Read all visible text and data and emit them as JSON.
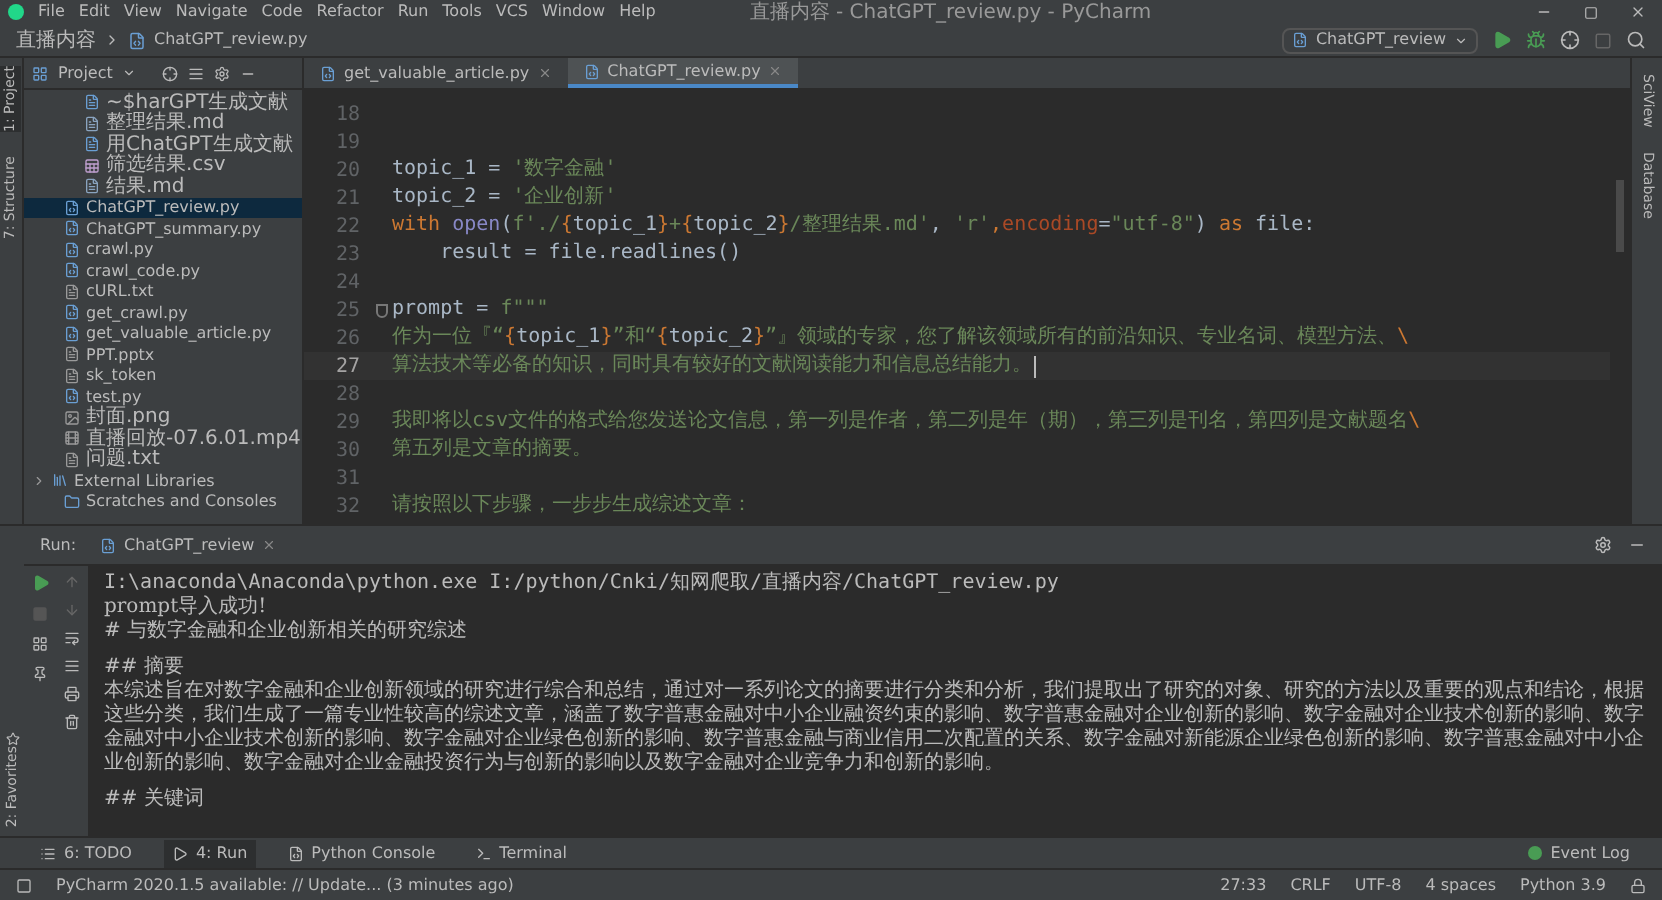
{
  "window": {
    "title": "直播内容 - ChatGPT_review.py - PyCharm"
  },
  "menu": [
    "File",
    "Edit",
    "View",
    "Navigate",
    "Code",
    "Refactor",
    "Run",
    "Tools",
    "VCS",
    "Window",
    "Help"
  ],
  "breadcrumb": [
    "直播内容",
    "ChatGPT_review.py"
  ],
  "run_config": "ChatGPT_review",
  "left_strip": [
    "1: Project",
    "7: Structure",
    "2: Favorites"
  ],
  "right_strip": [
    "SciView",
    "Database"
  ],
  "project": {
    "title": "Project",
    "tree": [
      {
        "children": [
          {
            "label": "~$harGPT生成文献",
            "kind": "doc",
            "selected": false
          },
          {
            "label": "整理结果.md",
            "kind": "md",
            "selected": false
          },
          {
            "label": "用ChatGPT生成文献",
            "kind": "doc",
            "selected": false
          },
          {
            "label": "筛选结果.csv",
            "kind": "csv",
            "selected": false
          },
          {
            "label": "结果.md",
            "kind": "md",
            "selected": false
          }
        ]
      },
      {
        "label": "ChatGPT_review.py",
        "kind": "py",
        "selected": true
      },
      {
        "label": "ChatGPT_summary.py",
        "kind": "py",
        "selected": false
      },
      {
        "label": "crawl.py",
        "kind": "py",
        "selected": false
      },
      {
        "label": "crawl_code.py",
        "kind": "py",
        "selected": false
      },
      {
        "label": "cURL.txt",
        "kind": "txt",
        "selected": false
      },
      {
        "label": "get_crawl.py",
        "kind": "py",
        "selected": false
      },
      {
        "label": "get_valuable_article.py",
        "kind": "py",
        "selected": false
      },
      {
        "label": "PPT.pptx",
        "kind": "txt",
        "selected": false
      },
      {
        "label": "sk_token",
        "kind": "txt",
        "selected": false
      },
      {
        "label": "test.py",
        "kind": "py",
        "selected": false
      },
      {
        "label": "封面.png",
        "kind": "png",
        "selected": false
      },
      {
        "label": "直播回放-07.6.01.mp4",
        "kind": "mp4",
        "selected": false
      },
      {
        "label": "问题.txt",
        "kind": "txt",
        "selected": false
      },
      {
        "label": "External Libraries",
        "kind": "lib",
        "expanded": false,
        "selected": false
      },
      {
        "label": "Scratches and Consoles",
        "kind": "scratch",
        "selected": false
      }
    ]
  },
  "editor_tabs": [
    {
      "label": "get_valuable_article.py",
      "selected": false
    },
    {
      "label": "ChatGPT_review.py",
      "selected": true
    }
  ],
  "code_lines": [
    {
      "number": "18",
      "current": false
    },
    {
      "number": "19",
      "current": false
    },
    {
      "number": "20",
      "current": false,
      "tokens": [
        {
          "kind": "plain",
          "text": "topic_1 = "
        },
        {
          "kind": "string",
          "text": "'数字金融'"
        }
      ]
    },
    {
      "number": "21",
      "current": false,
      "tokens": [
        {
          "kind": "plain",
          "text": "topic_2 = "
        },
        {
          "kind": "string",
          "text": "'企业创新'"
        }
      ]
    },
    {
      "number": "22",
      "current": false,
      "tokens": [
        {
          "kind": "keyword",
          "text": "with "
        },
        {
          "kind": "builtin",
          "text": "open"
        },
        {
          "kind": "plain",
          "text": "("
        },
        {
          "kind": "string",
          "text": "f'./"
        },
        {
          "kind": "brace",
          "text": "{"
        },
        {
          "kind": "plain",
          "text": "topic_1"
        },
        {
          "kind": "brace",
          "text": "}"
        },
        {
          "kind": "string",
          "text": "+"
        },
        {
          "kind": "brace",
          "text": "{"
        },
        {
          "kind": "plain",
          "text": "topic_2"
        },
        {
          "kind": "brace",
          "text": "}"
        },
        {
          "kind": "string",
          "text": "/整理结果.md'"
        },
        {
          "kind": "plain",
          "text": ", "
        },
        {
          "kind": "string",
          "text": "'r'"
        },
        {
          "kind": "keyword",
          "text": ","
        },
        {
          "kind": "param",
          "text": "encoding"
        },
        {
          "kind": "plain",
          "text": "="
        },
        {
          "kind": "string",
          "text": "\"utf-8\""
        },
        {
          "kind": "plain",
          "text": ") "
        },
        {
          "kind": "keyword",
          "text": "as "
        },
        {
          "kind": "plain",
          "text": "file:"
        }
      ]
    },
    {
      "number": "23",
      "current": false,
      "tokens": [
        {
          "kind": "plain",
          "text": "    result = file.readlines()"
        }
      ]
    },
    {
      "number": "24",
      "current": false
    },
    {
      "number": "25",
      "current": false,
      "fold": true,
      "tokens": [
        {
          "kind": "plain",
          "text": "prompt = "
        },
        {
          "kind": "string",
          "text": "f\"\"\""
        }
      ]
    },
    {
      "number": "26",
      "current": false,
      "tokens": [
        {
          "kind": "string",
          "text": "作为一位『“"
        },
        {
          "kind": "brace",
          "text": "{"
        },
        {
          "kind": "plain",
          "text": "topic_1"
        },
        {
          "kind": "brace",
          "text": "}"
        },
        {
          "kind": "string",
          "text": "”和“"
        },
        {
          "kind": "brace",
          "text": "{"
        },
        {
          "kind": "plain",
          "text": "topic_2"
        },
        {
          "kind": "brace",
          "text": "}"
        },
        {
          "kind": "string",
          "text": "”』领域的专家，您了解该领域所有的前沿知识、专业名词、模型方法、"
        },
        {
          "kind": "keyword",
          "text": "\\"
        }
      ]
    },
    {
      "number": "27",
      "current": true,
      "tokens": [
        {
          "kind": "string",
          "text": "算法技术等必备的知识，同时具有较好的文献阅读能力和信息总结能力。"
        }
      ]
    },
    {
      "number": "28",
      "current": false
    },
    {
      "number": "29",
      "current": false,
      "tokens": [
        {
          "kind": "string",
          "text": "我即将以csv文件的格式给您发送论文信息，第一列是作者，第二列是年（期），第三列是刊名，第四列是文献题名"
        },
        {
          "kind": "keyword",
          "text": "\\"
        }
      ]
    },
    {
      "number": "30",
      "current": false,
      "tokens": [
        {
          "kind": "string",
          "text": "第五列是文章的摘要。"
        }
      ]
    },
    {
      "number": "31",
      "current": false
    },
    {
      "number": "32",
      "current": false,
      "tokens": [
        {
          "kind": "string",
          "text": "请按照以下步骤，一步步生成综述文章："
        }
      ]
    }
  ],
  "run": {
    "label": "Run:",
    "tab": "ChatGPT_review",
    "console": [
      {
        "kind": "cmd",
        "text": "I:\\anaconda\\Anaconda\\python.exe I:/python/Cnki/知网爬取/直播内容/ChatGPT_review.py"
      },
      {
        "kind": "text",
        "text": "prompt导入成功!"
      },
      {
        "kind": "text",
        "text": "# 与数字金融和企业创新相关的研究综述"
      },
      {
        "kind": "gap"
      },
      {
        "kind": "text",
        "text": "## 摘要"
      },
      {
        "kind": "text",
        "text": "本综述旨在对数字金融和企业创新领域的研究进行综合和总结，通过对一系列论文的摘要进行分类和分析，我们提取出了研究的对象、研究的方法以及重要的观点和结论，根据这些分类，我们生成了一篇专业性较高的综述文章，涵盖了数字普惠金融对中小企业融资约束的影响、数字普惠金融对企业创新的影响、数字金融对企业技术创新的影响、数字金融对中小企业技术创新的影响、数字金融对企业绿色创新的影响、数字普惠金融与商业信用二次配置的关系、数字金融对新能源企业绿色创新的影响、数字普惠金融对中小企业创新的影响、数字金融对企业金融投资行为与创新的影响以及数字金融对企业竞争力和创新的影响。"
      },
      {
        "kind": "gap"
      },
      {
        "kind": "text",
        "text": "## 关键词"
      }
    ]
  },
  "bottom_tabs": [
    {
      "label": "6: TODO",
      "kind": "list",
      "selected": false
    },
    {
      "label": "4: Run",
      "kind": "run",
      "selected": true
    },
    {
      "label": "Python Console",
      "kind": "python",
      "selected": false
    },
    {
      "label": "Terminal",
      "kind": "terminal",
      "selected": false
    }
  ],
  "event_log": "Event Log",
  "status_bar": {
    "message": "PyCharm 2020.1.5 available: // Update... (3 minutes ago)",
    "items": [
      "27:33",
      "CRLF",
      "UTF-8",
      "4 spaces",
      "Python 3.9"
    ]
  }
}
